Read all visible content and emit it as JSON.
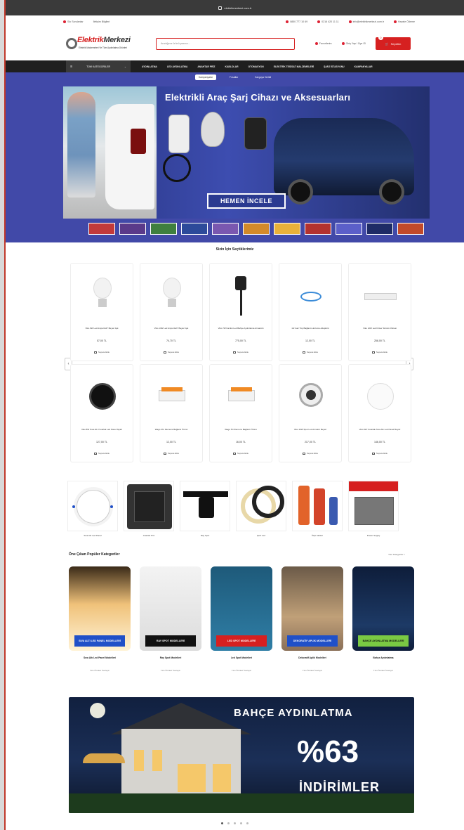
{
  "browser": {
    "url": "elektrikmerkezi.com.tr"
  },
  "topbar": {
    "left": [
      "Sık Sorulanlar",
      "İletişim Bilgileri"
    ],
    "right": [
      "0850 777 10 69",
      "0216 420 11 11",
      "info@elektrikmerkezi.com.tr",
      "Havale Ödeme"
    ]
  },
  "header": {
    "logo_main": "Elektrik",
    "logo_second": "Merkezi",
    "logo_tagline": "Elektrik Malzemeleri Ve Tüm Aydınlatma Ürünleri",
    "search_placeholder": "Aradığınız ürünü yazınız...",
    "favorites": "Favorilerim",
    "account": "Giriş Yap / Üye Ol",
    "cart_label": "Sepetim",
    "cart_count": "0"
  },
  "nav": {
    "categories": "TÜM KATEGORİLER",
    "items": [
      "AYDINLATMA",
      "LED AYDINLATMA",
      "ANAHTAR PRİZ",
      "KABLOLAR",
      "OTOMASYON",
      "ELEKTRİK TESİSAT MALZEMELERİ",
      "ŞARJ İSTASYONU",
      "KAMPANYALAR"
    ]
  },
  "hero": {
    "tabs": [
      "Kampanyalar",
      "Fırsatlar",
      "Kargoya Verildi"
    ],
    "active_tab": 0,
    "title": "Elektrikli Araç Şarj Cihazı ve Aksesuarları",
    "cta": "HEMEN İNCELE"
  },
  "recommended": {
    "title": "Sizin İçin Seçtiklerimiz",
    "add_label": "Sepete Ekle",
    "products": [
      {
        "name": "Viko 9W Led Ampul E27 Beyaz Işık",
        "price": "57,00 TL",
        "img": "bulb"
      },
      {
        "name": "Viko 13W Led Ampul E27 Beyaz Işık",
        "price": "74,70 TL",
        "img": "bulb"
      },
      {
        "name": "Viko 7W Kazıklı Led Bahçe Aydınlatma Armatürü",
        "price": "775,00 TL",
        "img": "spike"
      },
      {
        "name": "1/2 Gaz Tüp Bağlantı Hortumu Adaptörü",
        "price": "12,00 TL",
        "img": "hose"
      },
      {
        "name": "Viko 12W Led Driver Sürücü Ünitesi",
        "price": "258,00 TL",
        "img": "driver"
      },
      {
        "name": "Viko 8W Sıva Altı Yuvarlak Led Panel Siyah",
        "price": "127,00 TL",
        "img": "downlight"
      },
      {
        "name": "Wago 3'lü Klemens Bağlantı Ürünü",
        "price": "12,00 TL",
        "img": "wago"
      },
      {
        "name": "Wago 5'li Klemens Bağlantı Ürünü",
        "price": "16,00 TL",
        "img": "wago"
      },
      {
        "name": "Viko 10W Spot Led Armatür Beyaz",
        "price": "217,00 TL",
        "img": "spot"
      },
      {
        "name": "Viko 6W Yuvarlak Sıva Altı Led Panel Beyaz",
        "price": "146,00 TL",
        "img": "panel"
      }
    ]
  },
  "categories": [
    {
      "name": "Sıva Altı Led Panel",
      "img": "panel"
    },
    {
      "name": "Anahtar Priz",
      "img": "switch"
    },
    {
      "name": "Ray Spot",
      "img": "trackspot"
    },
    {
      "name": "Şerit Led",
      "img": "strip"
    },
    {
      "name": "Ölçü Aletleri",
      "img": "meter"
    },
    {
      "name": "Power Supply",
      "img": "psu"
    }
  ],
  "popular": {
    "title": "Öne Çıkan Popüler Kategoriler",
    "link": "Tüm Kategoriler >",
    "items": [
      {
        "label": "SIVA ALTI LED PANEL MODELLERİ",
        "title": "Sıva Altı Led Panel Modelleri",
        "sub": "Tüm Ürünleri İnceleyin",
        "color": "#2050c8",
        "img": "panel"
      },
      {
        "label": "RAY SPOT MODELLERİ",
        "title": "Ray Spot Modelleri",
        "sub": "Tüm Ürünleri İnceleyin",
        "color": "#111111",
        "img": "trackspot"
      },
      {
        "label": "LED SPOT MODELLERİ",
        "title": "Led Spot Modelleri",
        "sub": "Tüm Ürünleri İnceleyin",
        "color": "#d62020",
        "img": "ledspot"
      },
      {
        "label": "DEKORATİF APLİK MODELLERİ",
        "title": "Dekoratif Aplik Modelleri",
        "sub": "Tüm Ürünleri İnceleyin",
        "color": "#2050c8",
        "img": "sconce"
      },
      {
        "label": "BAHÇE AYDINLATMA MODELLERİ",
        "title": "Bahçe Aydınlatma",
        "sub": "Tüm Ürünleri İnceleyin",
        "color": "#7ac943",
        "img": "garden"
      }
    ]
  },
  "promo": {
    "title": "BAHÇE AYDINLATMA",
    "percent": "%63",
    "subtitle": "İNDİRİMLER"
  },
  "colors": {
    "accent": "#d62020",
    "hero_bg": "#4149a8",
    "nav_bg": "#1f1f1f"
  }
}
